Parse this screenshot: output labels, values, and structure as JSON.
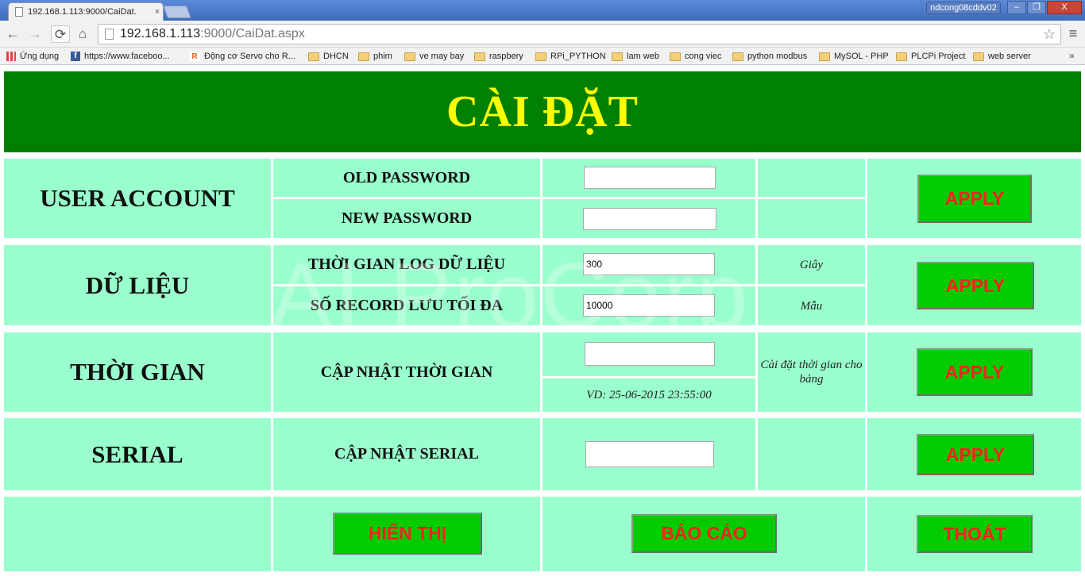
{
  "browser": {
    "tab_title": "192.168.1.113:9000/CaiDat.",
    "tab_close": "×",
    "profile_name": "ndcong08cddv02",
    "window_min": "–",
    "window_max": "❐",
    "window_close": "X",
    "nav_back": "←",
    "nav_forward": "→",
    "nav_reload": "⟳",
    "nav_home": "⌂",
    "url_host": "192.168.1.113",
    "url_path": ":9000/CaiDat.aspx",
    "star": "☆",
    "menu": "≡",
    "bookmarks_more": "»",
    "bookmarks": [
      {
        "label": "Ứng dụng",
        "icon": "apps-icon"
      },
      {
        "label": "https://www.faceboo...",
        "icon": "facebook-icon"
      },
      {
        "label": "Động cơ Servo cho R...",
        "icon": "rs-icon"
      },
      {
        "label": "DHCN",
        "icon": "folder-icon"
      },
      {
        "label": "phim",
        "icon": "folder-icon"
      },
      {
        "label": "ve may bay",
        "icon": "folder-icon"
      },
      {
        "label": "raspbery",
        "icon": "folder-icon"
      },
      {
        "label": "RPi_PYTHON",
        "icon": "folder-icon"
      },
      {
        "label": "lam web",
        "icon": "folder-icon"
      },
      {
        "label": "cong viec",
        "icon": "folder-icon"
      },
      {
        "label": "python modbus",
        "icon": "folder-icon"
      },
      {
        "label": "MySOL - PHP",
        "icon": "folder-icon"
      },
      {
        "label": "PLCPi Project",
        "icon": "folder-icon"
      },
      {
        "label": "web server",
        "icon": "folder-icon"
      }
    ]
  },
  "page": {
    "title": "CÀI ĐẶT",
    "watermark": "AI ProCorp",
    "colors": {
      "header_bg": "#008000",
      "header_text": "#ffff00",
      "cell_bg": "#99ffcc",
      "button_bg": "#00cc00",
      "button_text": "#ff2020"
    },
    "user_account": {
      "title": "USER ACCOUNT",
      "old_password_label": "OLD PASSWORD",
      "old_password_value": "",
      "new_password_label": "NEW PASSWORD",
      "new_password_value": "",
      "apply": "APPLY"
    },
    "du_lieu": {
      "title": "DỮ LIỆU",
      "log_time_label": "THỜI GIAN LOG DỮ LIỆU",
      "log_time_value": "300",
      "log_time_unit": "Giây",
      "max_record_label": "SỐ RECORD LƯU TỐI ĐA",
      "max_record_value": "10000",
      "max_record_unit": "Mẫu",
      "apply": "APPLY"
    },
    "thoi_gian": {
      "title": "THỜI GIAN",
      "update_label": "CẬP NHẬT THỜI GIAN",
      "update_value": "",
      "example": "VD: 25-06-2015 23:55:00",
      "note": "Cài đặt thời gian cho bảng",
      "apply": "APPLY"
    },
    "serial": {
      "title": "SERIAL",
      "update_label": "CẬP NHẬT SERIAL",
      "update_value": "",
      "apply": "APPLY"
    },
    "actions": {
      "show": "HIỂN THỊ",
      "report": "BÁO CÁO",
      "exit": "THOÁT"
    }
  }
}
